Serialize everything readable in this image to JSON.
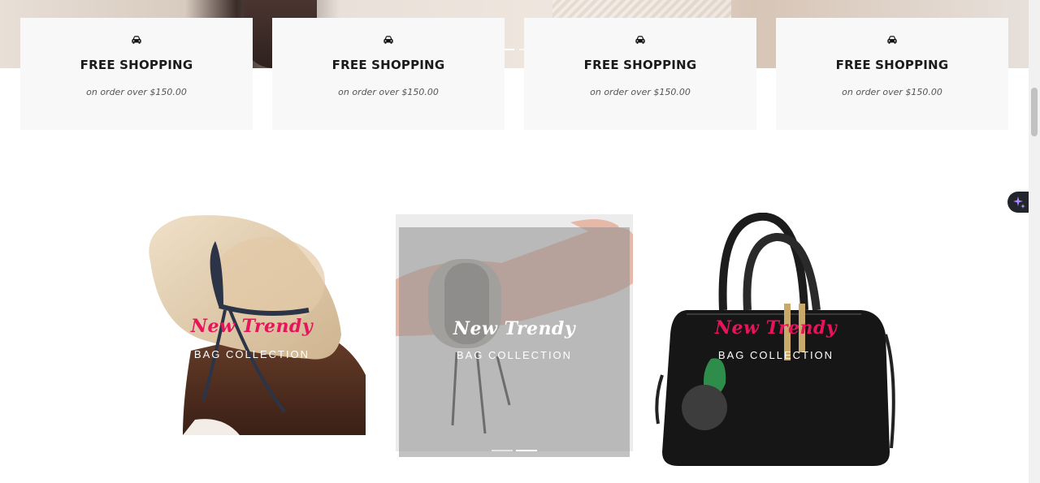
{
  "features": [
    {
      "icon": "car-icon",
      "title": "FREE SHOPPING",
      "subtitle": "on order over $150.00"
    },
    {
      "icon": "car-icon",
      "title": "FREE SHOPPING",
      "subtitle": "on order over $150.00"
    },
    {
      "icon": "car-icon",
      "title": "FREE SHOPPING",
      "subtitle": "on order over $150.00"
    },
    {
      "icon": "car-icon",
      "title": "FREE SHOPPING",
      "subtitle": "on order over $150.00"
    }
  ],
  "collections": [
    {
      "image": "straw-hat",
      "title": "New Trendy",
      "subtitle": "BAG COLLECTION"
    },
    {
      "image": "bracelet",
      "title": "New Trendy",
      "subtitle": "BAG COLLECTION"
    },
    {
      "image": "black-handbag",
      "title": "New Trendy",
      "subtitle": "BAG COLLECTION"
    }
  ],
  "colors": {
    "accent_pink": "#e8145b",
    "feature_bg": "#f8f8f8",
    "title_text": "#1b1b1b"
  }
}
